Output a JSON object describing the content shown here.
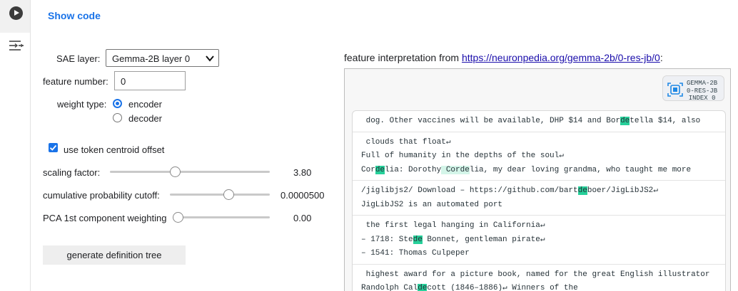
{
  "cell": {
    "show_code": "Show code",
    "run_icon": "play-icon",
    "form_icon": "form-toggle-icon"
  },
  "form": {
    "sae_layer_label": "SAE layer:",
    "sae_layer_value": "Gemma-2B layer 0",
    "feature_number_label": "feature number:",
    "feature_number_value": "0",
    "weight_type_label": "weight type:",
    "weight_options": [
      {
        "label": "encoder",
        "selected": true
      },
      {
        "label": "decoder",
        "selected": false
      }
    ],
    "centroid_label": "use token centroid offset",
    "centroid_checked": true,
    "sliders": [
      {
        "label": "scaling factor:",
        "value": "3.80",
        "level": 0.4
      },
      {
        "label": "cumulative probability cutoff:",
        "value": "0.0000500",
        "level": 0.6
      },
      {
        "label": "PCA 1st component weighting",
        "value": "0.00",
        "level": 0.0
      }
    ],
    "generate_button": "generate definition tree"
  },
  "interpretation": {
    "prefix": "feature interpretation from ",
    "link_text": "https://neuronpedia.org/gemma-2b/0-res-jb/0",
    "suffix": ":",
    "badge_lines": [
      "GEMMA-2B",
      "0-RES-JB",
      "INDEX 0"
    ],
    "badge_icon": "chip-icon",
    "highlight_color": "#26d09a",
    "examples": [
      [
        [
          " dog. Other vaccines will be available, DHP $14 and Bor",
          {
            "hl": "de"
          },
          "tella $14, also"
        ]
      ],
      [
        [
          " clouds that float↵"
        ],
        [
          "Full of humanity in the depths of the soul↵"
        ],
        [
          "Cor",
          {
            "hl": "de"
          },
          "lia: Dorothy",
          {
            "lt": " Corde"
          },
          "lia, my dear loving grandma, who taught me more"
        ]
      ],
      [
        [
          "/jiglibjs2/ Download – https://github.com/bart",
          {
            "hl": "de"
          },
          "boer/JigLibJS2↵"
        ],
        [
          "JigLibJS2 is an automated port"
        ]
      ],
      [
        [
          " the first legal hanging in California↵"
        ],
        [
          "– 1718: Ste",
          {
            "hl": "de"
          },
          " Bonnet, gentleman pirate↵"
        ],
        [
          "– 1541: Thomas Culpeper"
        ]
      ],
      [
        [
          " highest award for a picture book, named for the great English illustrator"
        ],
        [
          "Randolph Cal",
          {
            "hl": "de"
          },
          "cott (1846–1886)↵ Winners of the"
        ]
      ]
    ]
  }
}
